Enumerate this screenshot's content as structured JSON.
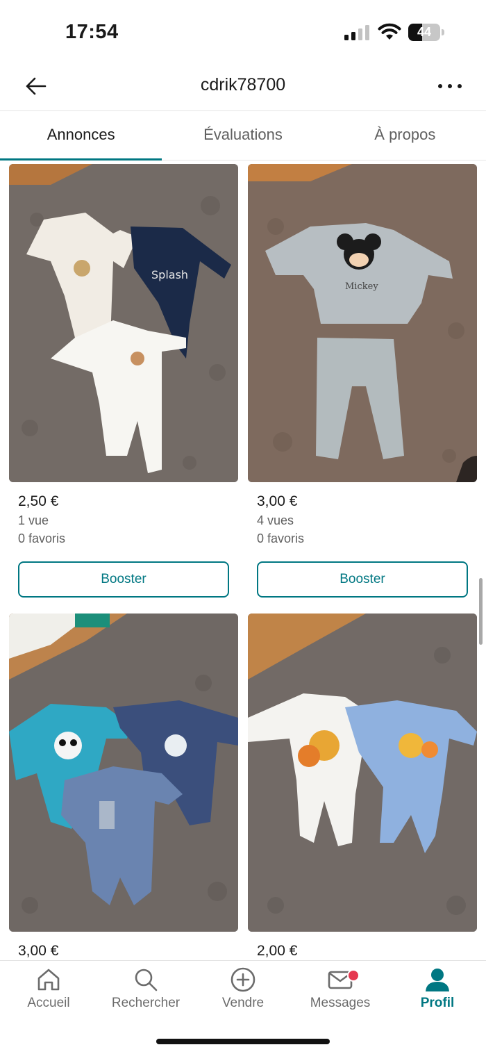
{
  "status_bar": {
    "time": "17:54",
    "battery": "44",
    "battery_level": 0.44
  },
  "header": {
    "title": "cdrik78700",
    "back_icon": "arrow-left-icon",
    "more_icon": "ellipsis-icon"
  },
  "tabs": [
    {
      "label": "Annonces",
      "active": true
    },
    {
      "label": "Évaluations",
      "active": false
    },
    {
      "label": "À propos",
      "active": false
    }
  ],
  "listings": [
    {
      "price": "2,50 €",
      "views": "1 vue",
      "favorites": "0 favoris",
      "action": "Booster",
      "photo": "three baby sleepsuits on grey carpet"
    },
    {
      "price": "3,00 €",
      "views": "4 vues",
      "favorites": "0 favoris",
      "action": "Booster",
      "photo": "Mickey grey top and pants set"
    },
    {
      "price": "3,00 €",
      "photo": "three blue baby sleepsuits with panda and bear"
    },
    {
      "price": "2,00 €",
      "photo": "two Winnie the Pooh baby sleepsuits"
    }
  ],
  "bottom_nav": [
    {
      "label": "Accueil",
      "icon": "home-icon",
      "active": false
    },
    {
      "label": "Rechercher",
      "icon": "search-icon",
      "active": false
    },
    {
      "label": "Vendre",
      "icon": "plus-circle-icon",
      "active": false
    },
    {
      "label": "Messages",
      "icon": "mail-icon",
      "active": false,
      "badge": true
    },
    {
      "label": "Profil",
      "icon": "profile-icon",
      "active": true
    }
  ],
  "colors": {
    "accent": "#007782",
    "badge": "#e5374f",
    "carpet": "#7a726c"
  }
}
